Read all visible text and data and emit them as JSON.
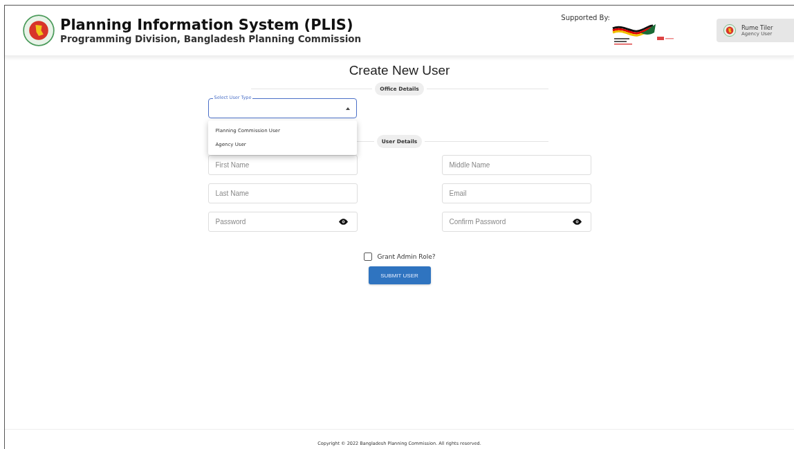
{
  "header": {
    "title": "Planning Information System (PLIS)",
    "subtitle": "Programming Division, Bangladesh Planning Commission",
    "supported_by": "Supported By:",
    "user": {
      "name": "Rume Tiler",
      "role": "Agency User"
    }
  },
  "page_title": "Create New User",
  "office_section": {
    "label": "Office Details",
    "select": {
      "label": "Select User Type",
      "open": true,
      "options": [
        {
          "label": "Planning Commission User",
          "selected": false
        },
        {
          "label": "Agency User",
          "selected": false
        }
      ]
    }
  },
  "user_section": {
    "label": "User Details",
    "fields": [
      {
        "placeholder": "First Name",
        "kind": "text"
      },
      {
        "placeholder": "Middle Name",
        "kind": "text"
      },
      {
        "placeholder": "Last Name",
        "kind": "text"
      },
      {
        "placeholder": "Email",
        "kind": "text"
      },
      {
        "placeholder": "Password",
        "kind": "password"
      },
      {
        "placeholder": "Confirm Password",
        "kind": "password"
      }
    ]
  },
  "admin_checkbox": {
    "label": "Grant Admin Role?",
    "checked": false
  },
  "submit_button": "SUBMIT USER",
  "footer": "Copyright © 2022 Bangladesh Planning Commission. All rights reserved."
}
